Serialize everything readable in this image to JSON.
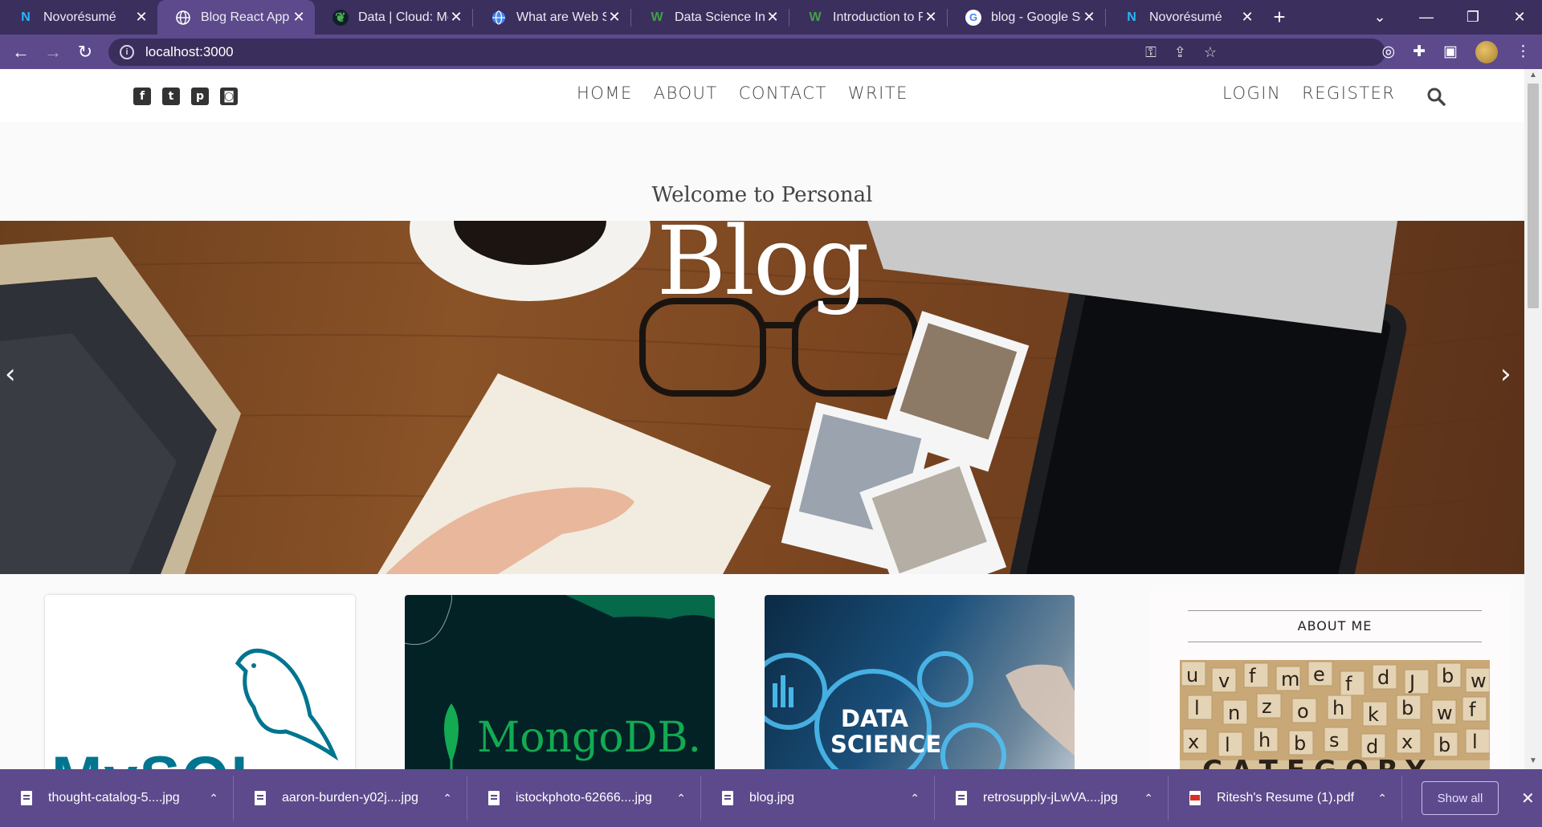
{
  "browser": {
    "tabs": [
      {
        "title": "Novorésumé",
        "favicon": "novoresume-icon",
        "color": "#4fc3f7",
        "active": false
      },
      {
        "title": "Blog React App",
        "favicon": "globe-icon",
        "color": "#ffffff",
        "active": true
      },
      {
        "title": "Data | Cloud: Mo",
        "favicon": "mongodb-leaf-icon",
        "color": "#4caf50",
        "active": false
      },
      {
        "title": "What are Web Se",
        "favicon": "globe-icon",
        "color": "#4285f4",
        "active": false
      },
      {
        "title": "Data Science Intr",
        "favicon": "w3-icon",
        "color": "#43a047",
        "active": false
      },
      {
        "title": "Introduction to R",
        "favicon": "w3-icon",
        "color": "#43a047",
        "active": false
      },
      {
        "title": "blog - Google Se",
        "favicon": "google-icon",
        "color": "#ffffff",
        "active": false
      },
      {
        "title": "Novorésumé",
        "favicon": "novoresume-icon",
        "color": "#4fc3f7",
        "active": false
      }
    ],
    "address": "localhost:3000"
  },
  "site": {
    "nav": [
      "HOME",
      "ABOUT",
      "CONTACT",
      "WRITE"
    ],
    "auth": [
      "LOGIN",
      "REGISTER"
    ],
    "social": [
      "facebook-icon",
      "twitter-icon",
      "pinterest-icon",
      "instagram-icon"
    ]
  },
  "hero": {
    "subtitle": "Welcome to Personal",
    "title": "Blog",
    "prev": "‹",
    "next": "›"
  },
  "posts": [
    {
      "image": "mysql-logo",
      "label": "MySQL"
    },
    {
      "image": "mongodb-logo",
      "label": "MongoDB."
    },
    {
      "image": "data-science-graphic",
      "label": "DATA SCIENCE"
    }
  ],
  "sidebar": {
    "about_title": "ABOUT ME",
    "image_text": "CATEGORY"
  },
  "downloads": {
    "items": [
      {
        "name": "thought-catalog-5....jpg",
        "type": "jpg"
      },
      {
        "name": "aaron-burden-y02j....jpg",
        "type": "jpg"
      },
      {
        "name": "istockphoto-62666....jpg",
        "type": "jpg"
      },
      {
        "name": "blog.jpg",
        "type": "jpg"
      },
      {
        "name": "retrosupply-jLwVA....jpg",
        "type": "jpg"
      },
      {
        "name": "Ritesh's Resume (1).pdf",
        "type": "pdf"
      }
    ],
    "show_all": "Show all"
  }
}
